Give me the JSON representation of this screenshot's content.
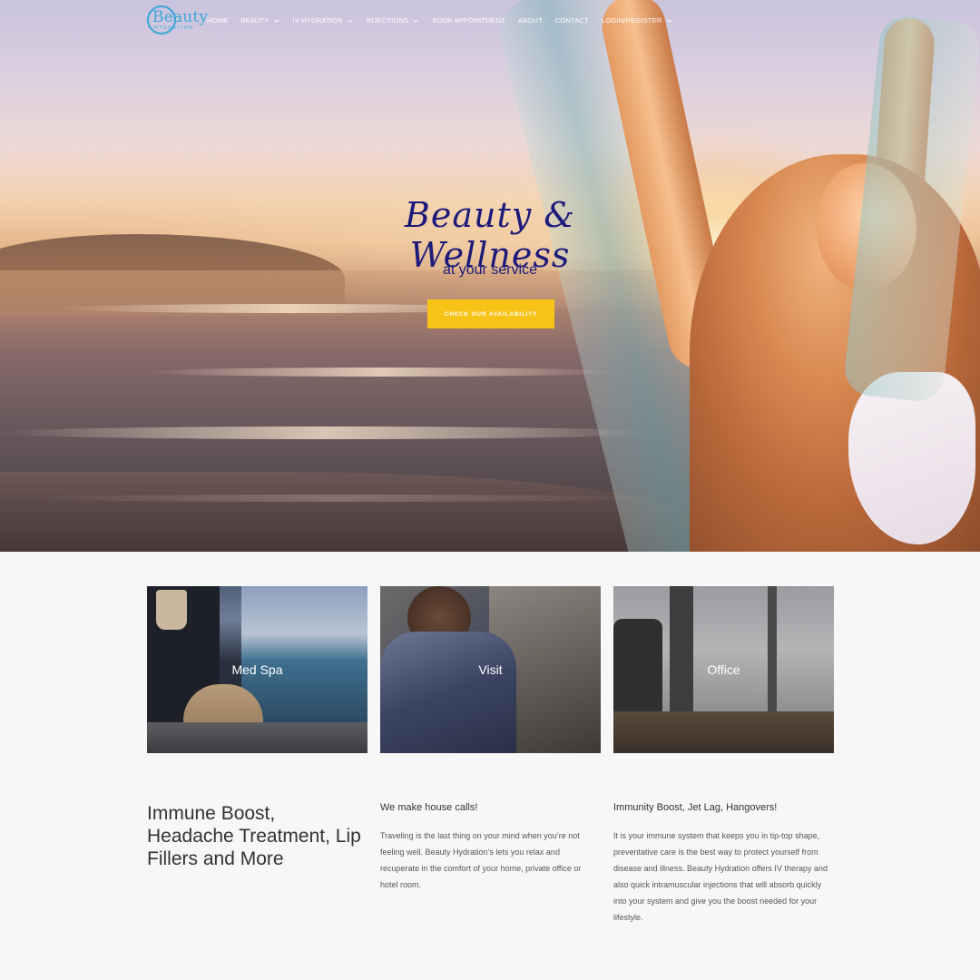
{
  "brand": {
    "logo_text": "Beauty",
    "logo_sub": "HYDRATION",
    "accent": "#3aa6d9"
  },
  "nav": {
    "items": [
      {
        "label": "HOME",
        "dropdown": false
      },
      {
        "label": "BEAUTY",
        "dropdown": true
      },
      {
        "label": "IV HYDRATION",
        "dropdown": true
      },
      {
        "label": "INJECTIONS",
        "dropdown": true
      },
      {
        "label": "BOOK APPOINTMENT",
        "dropdown": false
      },
      {
        "label": "ABOUT",
        "dropdown": false
      },
      {
        "label": "CONTACT",
        "dropdown": false
      },
      {
        "label": "LOGIN/REGISTER",
        "dropdown": true
      }
    ]
  },
  "hero": {
    "title": "Beauty & Wellness",
    "subtitle": "at your service",
    "cta_label": "CHECK OUR AVAILABILITY",
    "title_color": "#1c1a7a",
    "cta_color": "#f7c317"
  },
  "cards": [
    {
      "label": "Med Spa"
    },
    {
      "label": "Visit"
    },
    {
      "label": "Office"
    }
  ],
  "info": {
    "heading": "Immune Boost, Headache Treatment, Lip Fillers and More",
    "col2": {
      "title": "We make house calls!",
      "body": "Traveling is the last thing on your mind when you’re not feeling well. Beauty Hydration’s lets you relax and recuperate in the comfort of your home, private office or hotel room."
    },
    "col3": {
      "title": "Immunity Boost, Jet Lag, Hangovers!",
      "body": "It is your immune system that keeps you in tip-top shape, preventative care is the best way to protect yourself from disease and illness. Beauty Hydration offers IV therapy and also quick intramuscular injections that will absorb quickly into your system and give you the boost needed for your lifestyle."
    }
  }
}
